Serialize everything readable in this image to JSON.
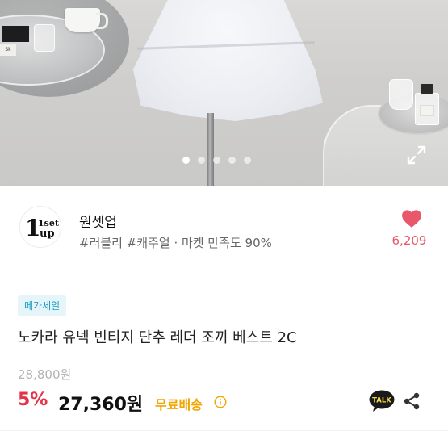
{
  "gallery": {
    "image_alt": "White tiered cotton dress on a hanger in a cafe",
    "dot_count": 5,
    "active_index": 0,
    "expand_icon": "expand-arrows-icon",
    "background_text": "Sk"
  },
  "shop": {
    "logo_line1": "1set",
    "logo_line2": "up",
    "name": "원셋업",
    "tags": "#러블리 #캐주얼 · 마켓 만족도 90%",
    "likes": "6,209",
    "heart_color": "#e8586a"
  },
  "product": {
    "badge": "메가세일",
    "title": "노카라 유넥 빈티지 단추 레더 조끼 베스트 2C",
    "original_price": "28,800원",
    "discount": "5%",
    "price": "27,360원",
    "shipping": "무료배송",
    "talk_label": "TALK"
  },
  "colors": {
    "discount": "#e5334a",
    "shipping": "#f0a500",
    "badge_bg": "#e5f5fa",
    "badge_text": "#1d9cc0"
  }
}
